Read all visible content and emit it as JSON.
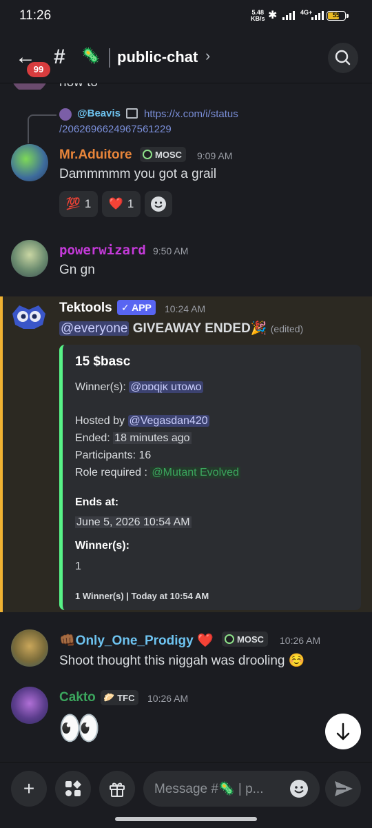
{
  "status_bar": {
    "time": "11:26",
    "net_speed": "5.48",
    "net_unit": "KB/s",
    "network": "4G+",
    "battery": "55"
  },
  "header": {
    "unread_badge": "99",
    "channel_name": "public-chat",
    "channel_emoji": "🦠"
  },
  "partial_message": {
    "text": "how to"
  },
  "reply_preview": {
    "author": "@Beavis",
    "link_line1": "https://x.com/i/status",
    "link_line2": "/2062696624967561229"
  },
  "messages": [
    {
      "author": "Mr.Aduitore",
      "author_color": "#e8853a",
      "tag": "MOSC",
      "time": "9:09 AM",
      "text": "Dammmmm you got a grail",
      "reactions": [
        {
          "emoji": "💯",
          "count": "1"
        },
        {
          "emoji": "❤️",
          "count": "1"
        }
      ]
    },
    {
      "author": "powerwizard",
      "author_color": "#c33ad8",
      "time": "9:50 AM",
      "text": "Gn gn"
    },
    {
      "author": "Tektools",
      "author_color": "#ffffff",
      "app_badge": "✓ APP",
      "time": "10:24 AM",
      "mention": "@everyone",
      "text": "GIVEAWAY ENDED",
      "text_emoji": "🎉",
      "edited": "(edited)"
    },
    {
      "author": "Only_One_Prodigy",
      "author_prefix": "👊🏾",
      "author_suffix": "❤️",
      "author_color": "#6ec3f0",
      "tag": "MOSC",
      "time": "10:26 AM",
      "text": "Shoot thought this niggah was drooling",
      "text_emoji": "☺️"
    },
    {
      "author": "Cakto",
      "author_color": "#3ba55d",
      "tag": "TFC",
      "tag_emoji": "🥟",
      "time": "10:26 AM",
      "text": "👀"
    }
  ],
  "embed": {
    "title": "15 $basc",
    "winners_label": "Winner(s):",
    "winner_mention": "@ɒɒqįĸ uτοʍο",
    "hosted_label": "Hosted by",
    "host_mention": "@Vegasdan420",
    "ended_label": "Ended:",
    "ended_value": "18 minutes ago",
    "participants": "Participants: 16",
    "role_label": "Role required :",
    "role_mention": "@Mutant Evolved",
    "ends_at_label": "Ends at:",
    "ends_at_value": "June 5, 2026 10:54 AM",
    "winners_field_label": "Winner(s):",
    "winners_field_value": "1",
    "footer": "1 Winner(s) | Today at 10:54 AM"
  },
  "composer": {
    "placeholder": "Message #🦠 | p..."
  },
  "colors": {
    "accent": "#5865f2",
    "highlight_bar": "#f0b232",
    "embed_bar": "#57f287"
  }
}
